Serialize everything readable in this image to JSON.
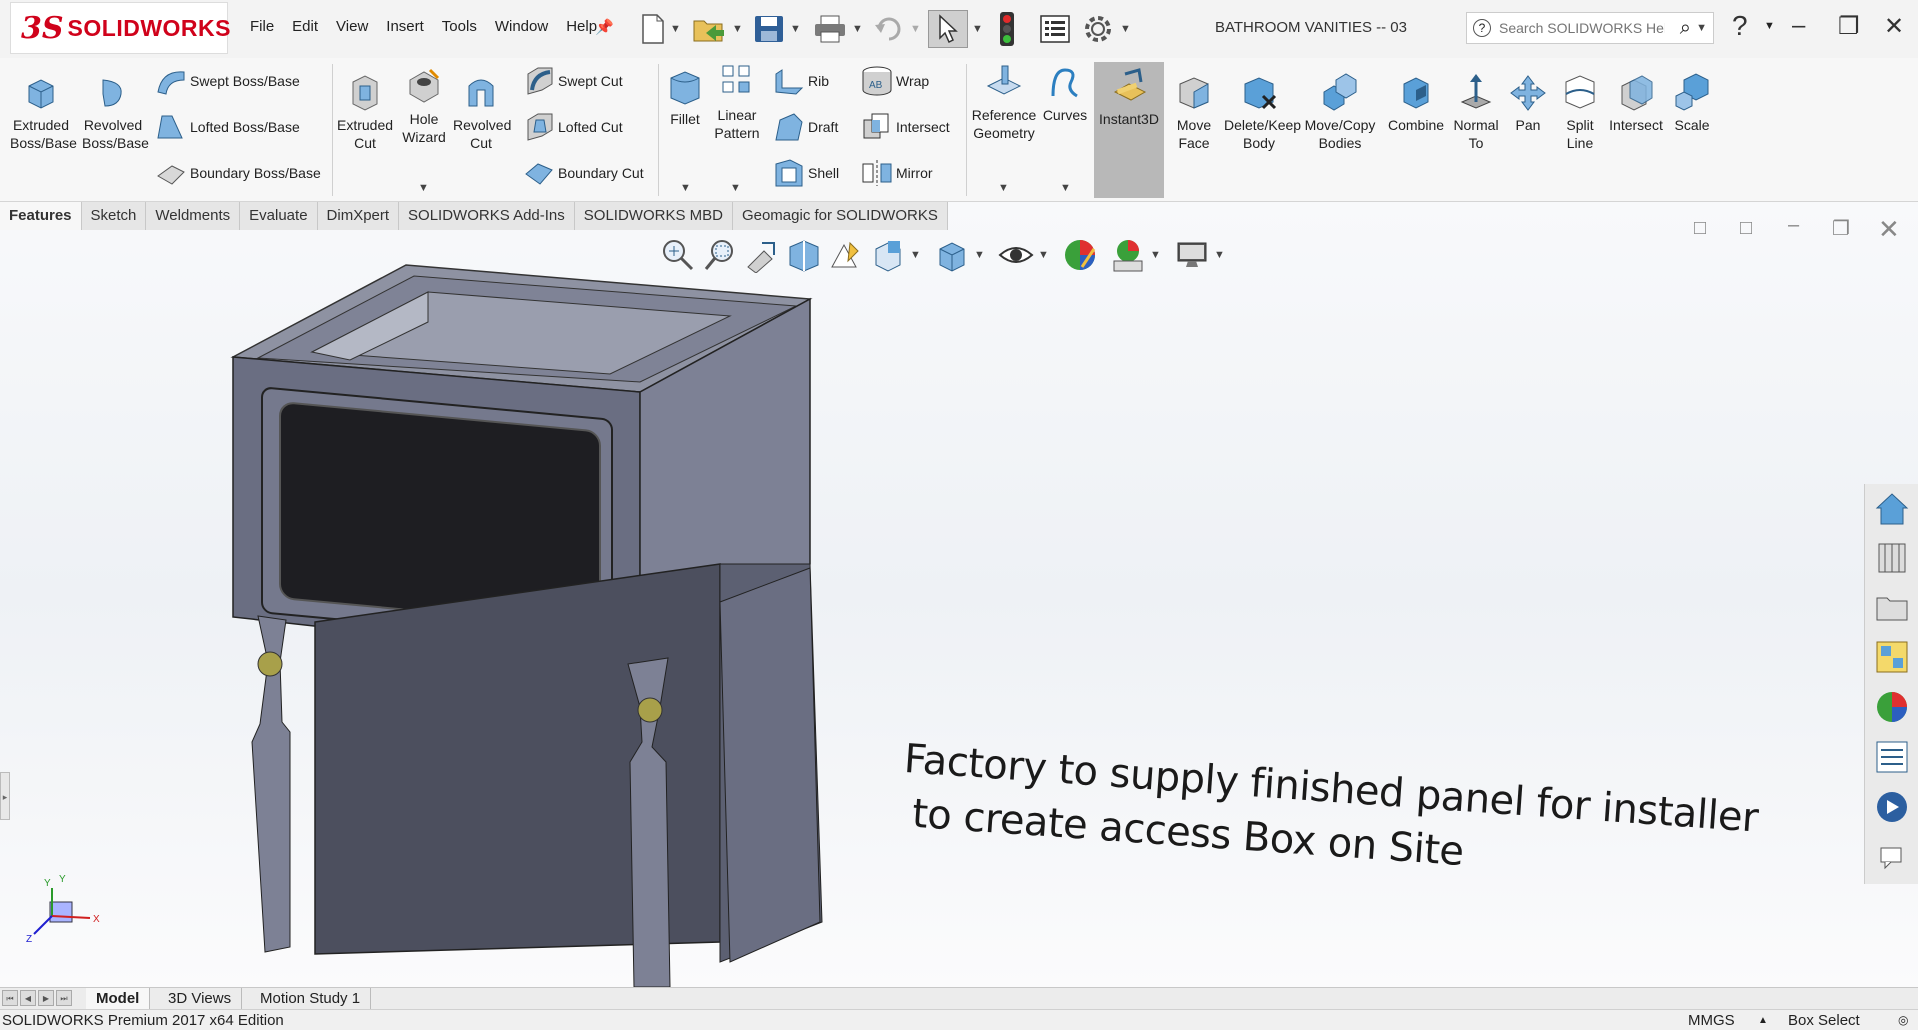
{
  "app": {
    "logo_ds": "3S",
    "logo_name": "SOLIDWORKS",
    "document_title": "BATHROOM VANITIES -- 03",
    "brand_color": "#d0021b"
  },
  "menu": [
    "File",
    "Edit",
    "View",
    "Insert",
    "Tools",
    "Window",
    "Help"
  ],
  "search": {
    "placeholder": "Search SOLIDWORKS Help"
  },
  "ribbon": {
    "features": {
      "extruded_boss": "Extruded Boss/Base",
      "revolved_boss": "Revolved Boss/Base",
      "swept_boss": "Swept Boss/Base",
      "lofted_boss": "Lofted Boss/Base",
      "boundary_boss": "Boundary Boss/Base",
      "extruded_cut": "Extruded Cut",
      "hole_wizard": "Hole Wizard",
      "revolved_cut": "Revolved Cut",
      "swept_cut": "Swept Cut",
      "lofted_cut": "Lofted Cut",
      "boundary_cut": "Boundary Cut",
      "fillet": "Fillet",
      "linear_pattern": "Linear Pattern",
      "rib": "Rib",
      "draft": "Draft",
      "shell": "Shell",
      "wrap": "Wrap",
      "intersect": "Intersect",
      "mirror": "Mirror",
      "reference_geometry": "Reference Geometry",
      "curves": "Curves",
      "instant3d": "Instant3D",
      "move_face": "Move Face",
      "delete_keep_body": "Delete/Keep Body",
      "move_copy_bodies": "Move/Copy Bodies",
      "combine": "Combine",
      "normal_to": "Normal To",
      "pan": "Pan",
      "split_line": "Split Line",
      "intersect2": "Intersect",
      "scale": "Scale"
    }
  },
  "command_tabs": [
    "Features",
    "Sketch",
    "Weldments",
    "Evaluate",
    "DimXpert",
    "SOLIDWORKS Add-Ins",
    "SOLIDWORKS MBD",
    "Geomagic for SOLIDWORKS"
  ],
  "viewport": {
    "note_line1": "Factory to supply finished panel for installer",
    "note_line2": "to create access Box on Site",
    "triad_x": "X",
    "triad_y": "Y",
    "triad_z": "Z"
  },
  "bottom_tabs": [
    "Model",
    "3D Views",
    "Motion Study 1"
  ],
  "status": {
    "edition": "SOLIDWORKS Premium 2017 x64 Edition",
    "units": "MMGS",
    "selection": "Box Select"
  }
}
